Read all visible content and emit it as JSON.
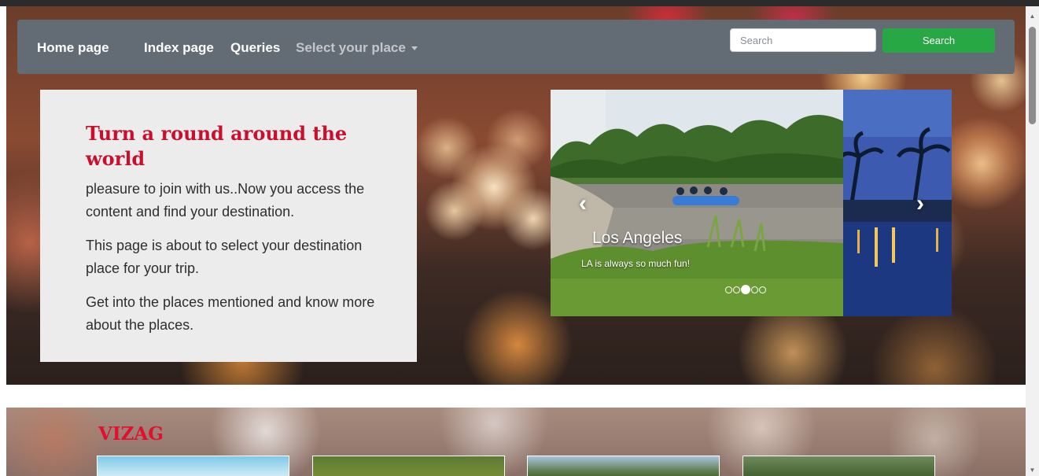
{
  "navbar": {
    "links": [
      "Home page",
      "Index page",
      "Queries"
    ],
    "dropdown_label": "Select your place",
    "search_placeholder": "Search",
    "search_button": "Search"
  },
  "intro": {
    "title": "Turn a round around the world",
    "paragraphs": [
      "pleasure to join with us..Now you access the content and find your destination.",
      "This page is about to select your destination place for your trip.",
      "Get into the places mentioned and know more about the places."
    ]
  },
  "carousel": {
    "caption_title": "Los Angeles",
    "caption_text": "LA is always so much fun!",
    "slide_count": 5,
    "active_index": 2
  },
  "section": {
    "title": "VIZAG"
  },
  "colors": {
    "navbar_bg": "#636b74",
    "search_button_bg": "#28a745",
    "title_red": "#c8102e"
  }
}
